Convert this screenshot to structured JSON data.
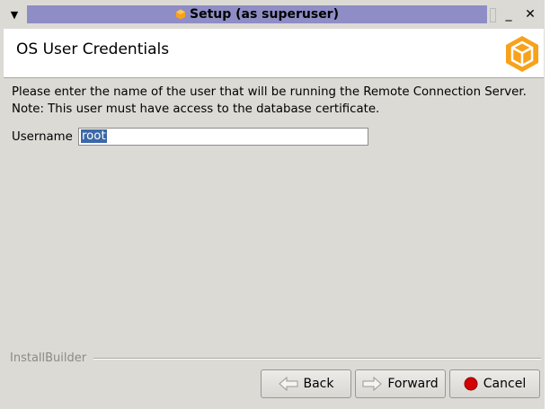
{
  "window": {
    "title": "Setup (as superuser)"
  },
  "header": {
    "title": "OS User Credentials"
  },
  "body": {
    "instruction_line1": "Please enter the name of the user that will be running the Remote Connection Server.",
    "instruction_line2": "Note: This user must have access to the database certificate.",
    "username_label": "Username",
    "username_value": "root"
  },
  "footer": {
    "builder_label": "InstallBuilder",
    "back_label": "Back",
    "forward_label": "Forward",
    "cancel_label": "Cancel"
  },
  "colors": {
    "title_bar": "#8f8dc5",
    "window_bg": "#dcdad5",
    "logo_orange": "#f7a21b",
    "selection": "#3c68a8",
    "cancel_icon": "#d40000"
  }
}
